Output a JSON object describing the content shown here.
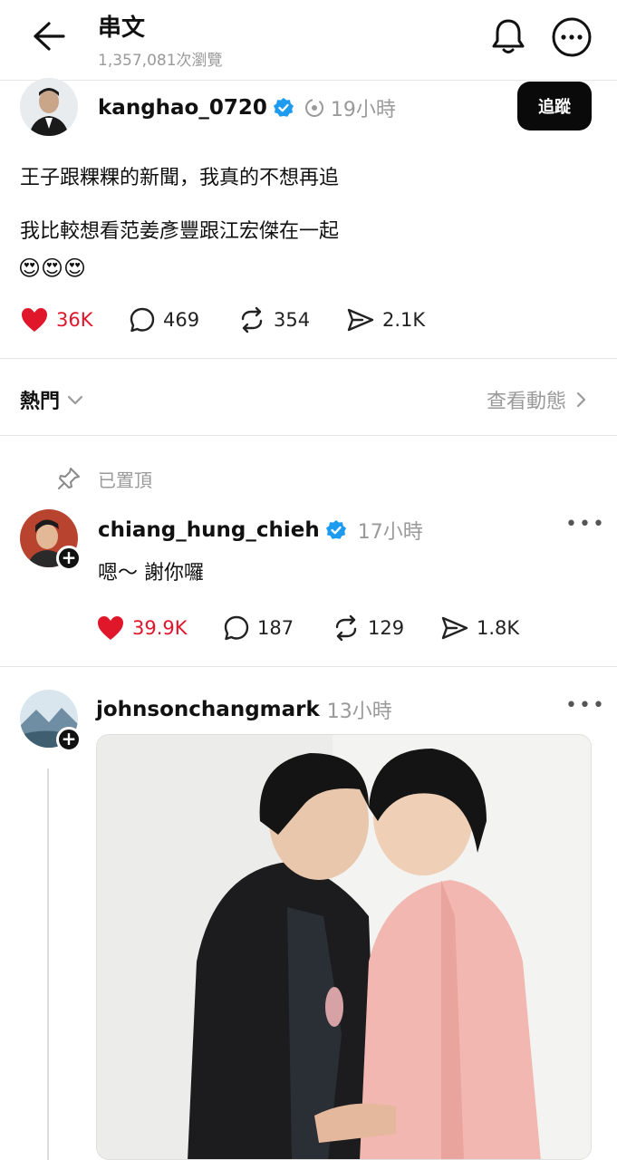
{
  "header": {
    "title": "串文",
    "views": "1,357,081次瀏覽"
  },
  "main_post": {
    "username": "kanghao_0720",
    "time": "19小時",
    "follow_label": "追蹤",
    "text_line1": "王子跟粿粿的新聞，我真的不想再追",
    "text_line2": "我比較想看范姜彥豐跟江宏傑在一起",
    "emojis": "😍😍😍",
    "likes": "36K",
    "comments": "469",
    "reposts": "354",
    "shares": "2.1K"
  },
  "sort_bar": {
    "sort_label": "熱門",
    "activity_link": "查看動態"
  },
  "reply1": {
    "pinned_label": "已置頂",
    "username": "chiang_hung_chieh",
    "time": "17小時",
    "text": "嗯～ 謝你囉",
    "likes": "39.9K",
    "comments": "187",
    "reposts": "129",
    "shares": "1.8K"
  },
  "reply2": {
    "username": "johnsonchangmark",
    "time": "13小時"
  },
  "colors": {
    "like_red": "#e0162b",
    "verified_blue": "#1d9bf0"
  }
}
